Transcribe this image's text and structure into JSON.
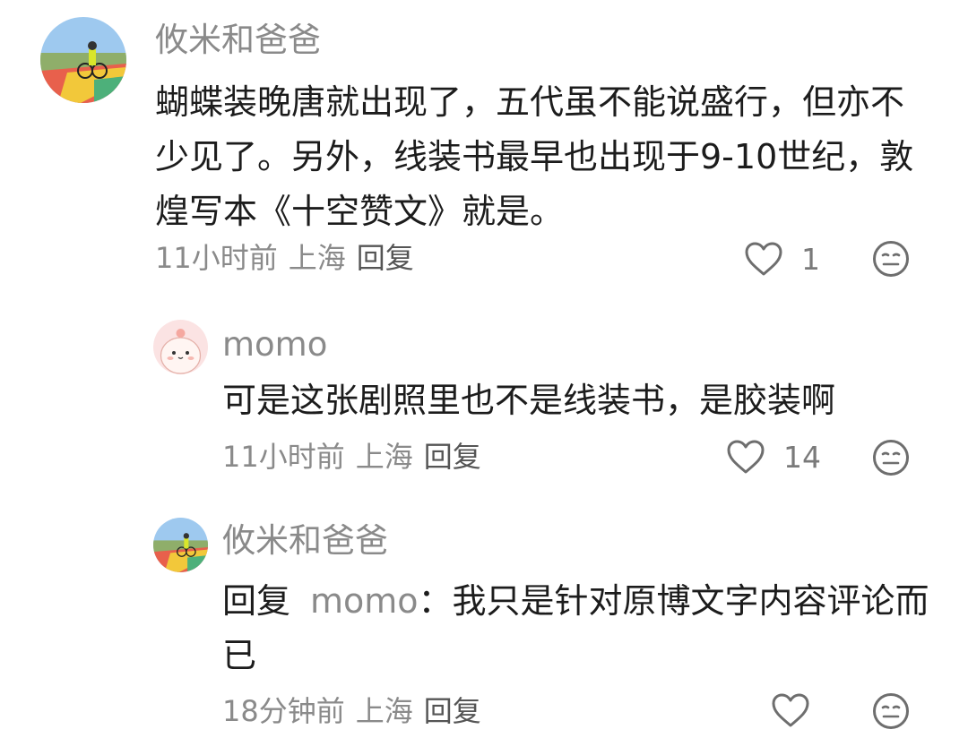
{
  "comments": [
    {
      "author": "攸米和爸爸",
      "text": "蝴蝶装晚唐就出现了，五代虽不能说盛行，但亦不少见了。另外，线装书最早也出现于9-10世纪，敦煌写本《十空赞文》就是。",
      "time": "11小时前",
      "location": "上海",
      "reply_label": "回复",
      "likes": "1"
    },
    {
      "author": "momo",
      "text": "可是这张剧照里也不是线装书，是胶装啊",
      "time": "11小时前",
      "location": "上海",
      "reply_label": "回复",
      "likes": "14"
    },
    {
      "author": "攸米和爸爸",
      "reply_prefix": "回复",
      "reply_target": "momo",
      "text": "：我只是针对原博文字内容评论而已",
      "time": "18分钟前",
      "location": "上海",
      "reply_label": "回复",
      "likes": ""
    }
  ],
  "icons": {
    "like": "heart-outline-icon",
    "dislike": "meh-face-icon"
  },
  "colors": {
    "meta_text": "#8a8a8a",
    "body_text": "#1c1c1c",
    "icon_stroke": "#6e6e6e"
  }
}
